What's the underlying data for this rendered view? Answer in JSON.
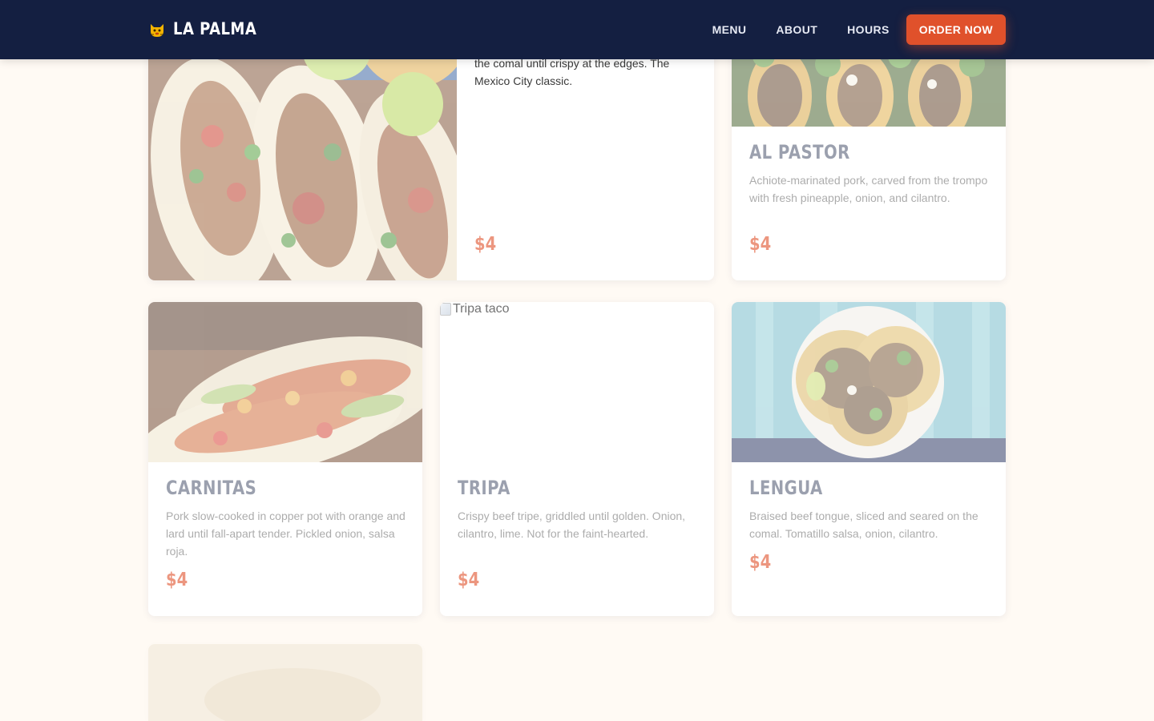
{
  "nav": {
    "brand": "LA PALMA",
    "brand_icon": "cat-face-icon",
    "links": [
      "MENU",
      "ABOUT",
      "HOURS"
    ],
    "cta": "ORDER NOW",
    "colors": {
      "background": "#141f41",
      "accent": "#e0512b"
    }
  },
  "cards": {
    "featured": {
      "description": "the comal until crispy at the edges. The Mexico City classic.",
      "price": "$4"
    },
    "al_pastor": {
      "title": "AL PASTOR",
      "description": "Achiote-marinated pork, carved from the trompo with fresh pineapple, onion, and cilantro.",
      "price": "$4"
    },
    "carnitas": {
      "title": "CARNITAS",
      "description": "Pork slow-cooked in copper pot with orange and lard until fall-apart tender. Pickled onion, salsa roja.",
      "price": "$4"
    },
    "tripa": {
      "title": "TRIPA",
      "image_alt": "Tripa taco",
      "description": "Crispy beef tripe, griddled until golden. Onion, cilantro, lime. Not for the faint-hearted.",
      "price": "$4"
    },
    "lengua": {
      "title": "LENGUA",
      "description": "Braised beef tongue, sliced and seared on the comal. Tomatillo salsa, onion, cilantro.",
      "price": "$4"
    }
  }
}
